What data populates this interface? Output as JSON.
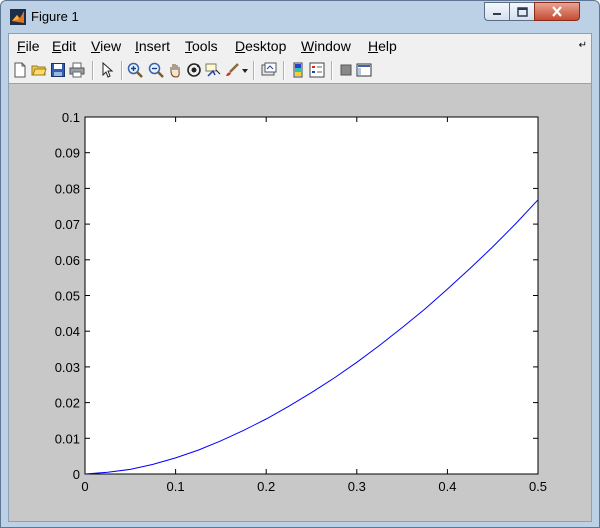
{
  "window": {
    "title": "Figure 1"
  },
  "menubar": {
    "items": [
      {
        "label": "File",
        "key": "F",
        "rest": "ile"
      },
      {
        "label": "Edit",
        "key": "E",
        "rest": "dit"
      },
      {
        "label": "View",
        "key": "V",
        "rest": "iew"
      },
      {
        "label": "Insert",
        "key": "I",
        "rest": "nsert"
      },
      {
        "label": "Tools",
        "key": "T",
        "rest": "ools"
      },
      {
        "label": "Desktop",
        "key": "D",
        "rest": "esktop"
      },
      {
        "label": "Window",
        "key": "W",
        "rest": "indow"
      },
      {
        "label": "Help",
        "key": "H",
        "rest": "elp"
      }
    ]
  },
  "toolbar": {
    "icons": [
      "new-figure-icon",
      "open-file-icon",
      "save-icon",
      "print-icon",
      "edit-plot-arrow-icon",
      "zoom-in-icon",
      "zoom-out-icon",
      "pan-hand-icon",
      "rotate-3d-icon",
      "data-cursor-icon",
      "brush-icon",
      "link-plot-icon",
      "insert-colorbar-icon",
      "insert-legend-icon",
      "hide-plot-tools-icon",
      "show-plot-tools-icon"
    ]
  },
  "chart_data": {
    "type": "line",
    "title": "",
    "xlabel": "",
    "ylabel": "",
    "xlim": [
      0,
      0.5
    ],
    "ylim": [
      0,
      0.1
    ],
    "xticks": [
      "0",
      "0.1",
      "0.2",
      "0.3",
      "0.4",
      "0.5"
    ],
    "yticks": [
      "0",
      "0.01",
      "0.02",
      "0.03",
      "0.04",
      "0.05",
      "0.06",
      "0.07",
      "0.08",
      "0.09",
      "0.1"
    ],
    "grid": false,
    "series": [
      {
        "color": "#0000ff",
        "x": [
          0,
          0.025,
          0.05,
          0.075,
          0.1,
          0.125,
          0.15,
          0.175,
          0.2,
          0.225,
          0.25,
          0.275,
          0.3,
          0.325,
          0.35,
          0.375,
          0.4,
          0.425,
          0.45,
          0.475,
          0.5
        ],
        "y": [
          0,
          0.0005,
          0.0013,
          0.0027,
          0.0045,
          0.0067,
          0.0093,
          0.0122,
          0.0154,
          0.019,
          0.0228,
          0.0269,
          0.0313,
          0.036,
          0.041,
          0.0462,
          0.0518,
          0.0576,
          0.0636,
          0.07,
          0.0768
        ]
      }
    ]
  }
}
